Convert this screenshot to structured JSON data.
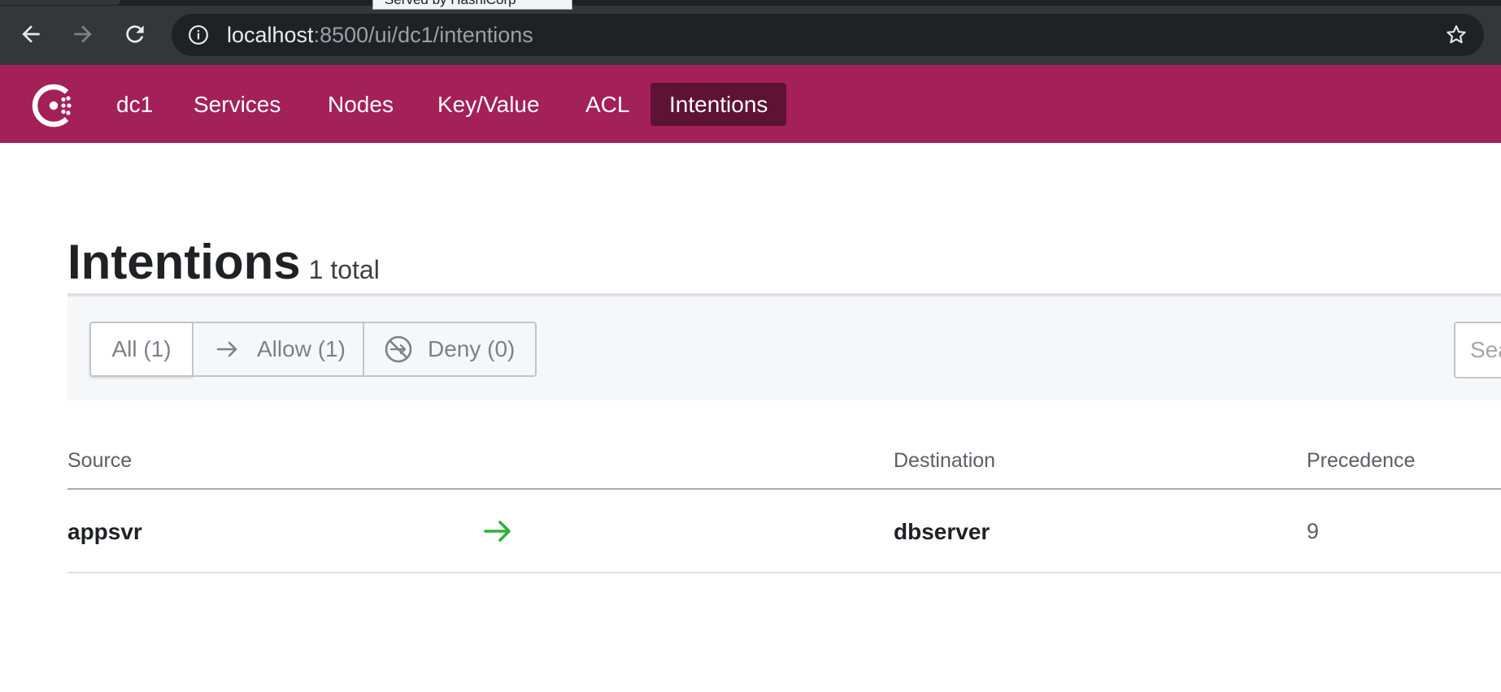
{
  "browser": {
    "tooltip": "Served by HashiCorp",
    "url_host": "localhost",
    "url_rest": ":8500/ui/dc1/intentions",
    "back_icon": "arrow-left-icon",
    "forward_icon": "arrow-right-icon",
    "reload_icon": "reload-icon",
    "info_icon": "info-icon",
    "bookmark_icon": "star-icon"
  },
  "header": {
    "logo_icon": "consul-logo-icon",
    "brand_color": "#a32059",
    "active_color": "#5e1234",
    "nav": [
      {
        "label": "dc1",
        "active": false
      },
      {
        "label": "Services",
        "active": false
      },
      {
        "label": "Nodes",
        "active": false
      },
      {
        "label": "Key/Value",
        "active": false
      },
      {
        "label": "ACL",
        "active": false
      },
      {
        "label": "Intentions",
        "active": true
      }
    ]
  },
  "page": {
    "title": "Intentions",
    "count": "1 total"
  },
  "filters": {
    "all": "All (1)",
    "allow": "Allow (1)",
    "deny": "Deny (0)",
    "allow_icon": "arrow-right-icon",
    "deny_icon": "deny-icon",
    "selected": "all",
    "search_placeholder": "Search"
  },
  "table": {
    "columns": [
      "Source",
      "Destination",
      "Precedence"
    ],
    "rows": [
      {
        "source": "appsvr",
        "action_icon": "allow-arrow-icon",
        "destination": "dbserver",
        "precedence": "9"
      }
    ],
    "allow_color": "#2eb039"
  }
}
